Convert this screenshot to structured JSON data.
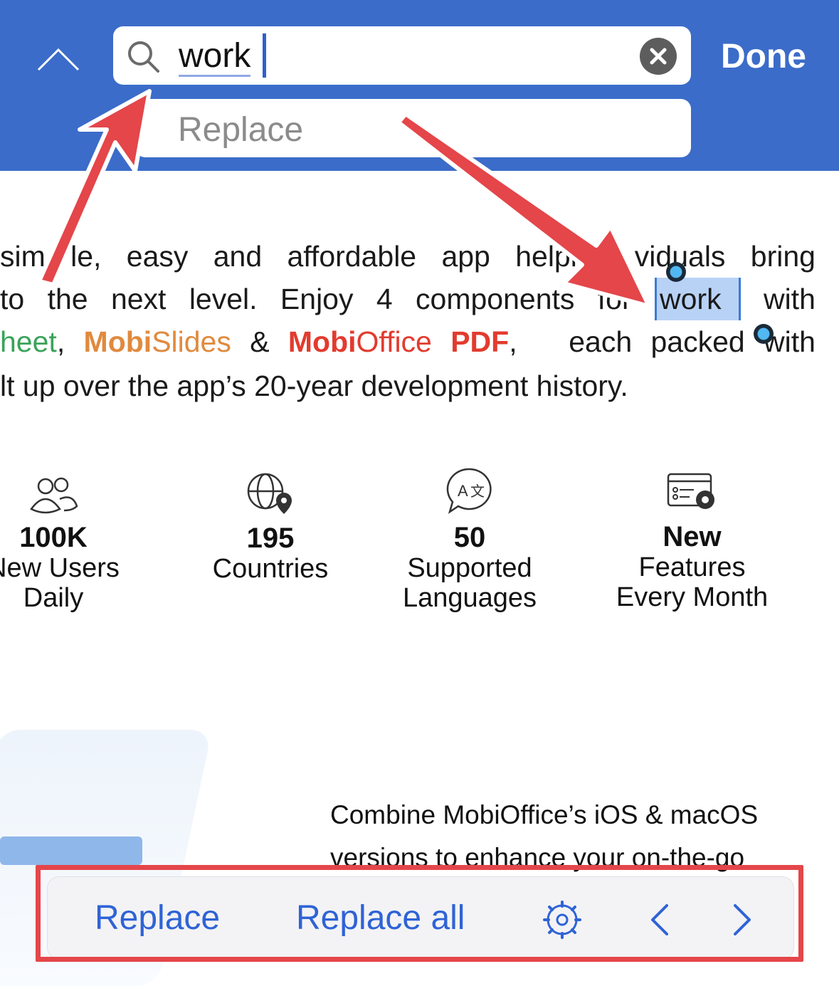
{
  "search": {
    "query": "work",
    "replace_placeholder": "Replace",
    "done_label": "Done"
  },
  "document": {
    "line1": [
      "sim",
      "le,",
      "easy",
      "and",
      "affordable",
      "app",
      "helping",
      "",
      "viduals",
      "bring"
    ],
    "line2": [
      "to",
      "the",
      "next",
      "level.",
      "Enjoy",
      "4",
      "components",
      "for",
      "work",
      "with"
    ],
    "line3": {
      "green_part": "heet",
      "comma1": ",",
      "mobi1": "Mobi",
      "slides": "Slides",
      "amp": "&",
      "mobi2": "Mobi",
      "office": "Office",
      "pdf": "PDF",
      "comma2": ",",
      "rest1": "each",
      "rest2": "packed",
      "rest3": "with"
    },
    "line4": "lt up over the app’s 20-year development history.",
    "combine_line1": "Combine MobiOffice’s iOS & macOS",
    "combine_line2": "versions to enhance your on-the-go"
  },
  "stats": [
    {
      "icon": "users-icon",
      "value": "100K",
      "label1": "New Users",
      "label2": "Daily"
    },
    {
      "icon": "globe-location-icon",
      "value": "195",
      "label1": "Countries",
      "label2": ""
    },
    {
      "icon": "translate-icon",
      "value": "50",
      "label1": "Supported",
      "label2": "Languages"
    },
    {
      "icon": "settings-window-icon",
      "value": "New",
      "label1": "Features",
      "label2": "Every Month"
    }
  ],
  "bottom_bar": {
    "replace_label": "Replace",
    "replace_all_label": "Replace all"
  },
  "colors": {
    "topbar": "#3b6cc9",
    "accent": "#2f63d6",
    "annotation_red": "#e4464a",
    "highlight": "#b8d2f5"
  }
}
